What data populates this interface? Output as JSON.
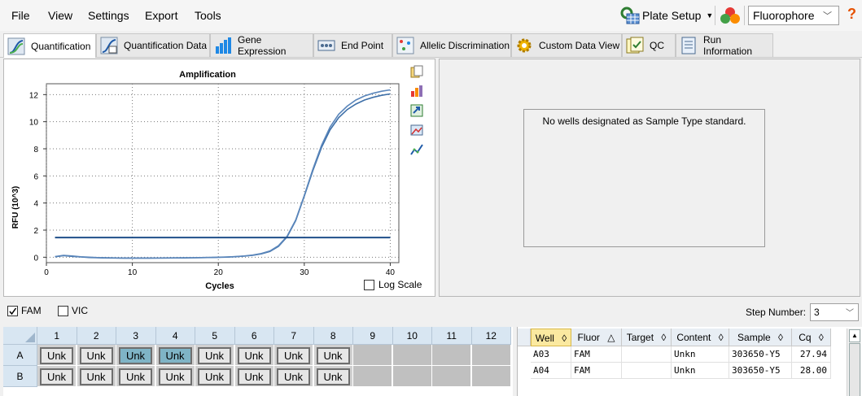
{
  "menu": [
    "File",
    "View",
    "Settings",
    "Export",
    "Tools"
  ],
  "toolbar": {
    "plate_setup": "Plate Setup",
    "fluorophore_select": "Fluorophore",
    "help": "?"
  },
  "tabs": [
    {
      "label": "Quantification",
      "active": true,
      "icon": "amplification-icon"
    },
    {
      "label": "Quantification Data",
      "active": false,
      "icon": "quant-data-icon"
    },
    {
      "label": "Gene Expression",
      "active": false,
      "icon": "bar-chart-icon"
    },
    {
      "label": "End Point",
      "active": false,
      "icon": "end-point-icon"
    },
    {
      "label": "Allelic Discrimination",
      "active": false,
      "icon": "scatter-icon"
    },
    {
      "label": "Custom Data View",
      "active": false,
      "icon": "gear-icon"
    },
    {
      "label": "QC",
      "active": false,
      "icon": "qc-icon"
    },
    {
      "label": "Run Information",
      "active": false,
      "icon": "document-icon"
    }
  ],
  "chart_data": {
    "type": "line",
    "title": "Amplification",
    "xlabel": "Cycles",
    "ylabel": "RFU (10^3)",
    "xlim": [
      0,
      41
    ],
    "ylim": [
      -0.4,
      12.8
    ],
    "xticks": [
      0,
      10,
      20,
      30,
      40
    ],
    "yticks": [
      0,
      2,
      4,
      6,
      8,
      10,
      12
    ],
    "grid": "dotted",
    "threshold": 1.45,
    "series": [
      {
        "x": [
          1,
          2,
          3,
          4,
          5,
          6,
          7,
          8,
          9,
          10,
          11,
          12,
          13,
          14,
          15,
          16,
          17,
          18,
          19,
          20,
          21,
          22,
          23,
          24,
          25,
          26,
          27,
          28,
          29,
          30,
          31,
          32,
          33,
          34,
          35,
          36,
          37,
          38,
          39,
          40
        ],
        "values": [
          0.03,
          0.12,
          0.06,
          0.02,
          -0.02,
          -0.04,
          -0.05,
          -0.06,
          -0.07,
          -0.07,
          -0.07,
          -0.07,
          -0.06,
          -0.06,
          -0.05,
          -0.05,
          -0.04,
          -0.03,
          -0.02,
          -0.01,
          0.01,
          0.04,
          0.08,
          0.14,
          0.25,
          0.42,
          0.8,
          1.5,
          2.7,
          4.5,
          6.4,
          8.1,
          9.4,
          10.3,
          10.9,
          11.3,
          11.6,
          11.8,
          11.95,
          12.05
        ],
        "color": "#3d6fa8"
      },
      {
        "x": [
          1,
          2,
          3,
          4,
          5,
          6,
          7,
          8,
          9,
          10,
          11,
          12,
          13,
          14,
          15,
          16,
          17,
          18,
          19,
          20,
          21,
          22,
          23,
          24,
          25,
          26,
          27,
          28,
          29,
          30,
          31,
          32,
          33,
          34,
          35,
          36,
          37,
          38,
          39,
          40
        ],
        "values": [
          0.05,
          0.14,
          0.09,
          0.03,
          0.0,
          -0.03,
          -0.04,
          -0.05,
          -0.06,
          -0.06,
          -0.06,
          -0.06,
          -0.06,
          -0.05,
          -0.05,
          -0.04,
          -0.04,
          -0.03,
          -0.02,
          0.0,
          0.02,
          0.05,
          0.09,
          0.16,
          0.27,
          0.46,
          0.85,
          1.55,
          2.75,
          4.55,
          6.5,
          8.25,
          9.6,
          10.55,
          11.15,
          11.6,
          11.9,
          12.1,
          12.25,
          12.35
        ],
        "color": "#5a86bb"
      }
    ],
    "threshold_color": "#1f4f8a"
  },
  "log_scale_label": "Log Scale",
  "chart_side_icons": [
    "copy-icon",
    "chart-colors-icon",
    "export-icon",
    "image-icon",
    "line-style-icon"
  ],
  "std_curve_message": "No wells designated as Sample Type standard.",
  "fluors": [
    {
      "label": "FAM",
      "checked": true
    },
    {
      "label": "VIC",
      "checked": false
    }
  ],
  "step": {
    "label": "Step Number:",
    "value": "3"
  },
  "plate": {
    "columns": [
      "1",
      "2",
      "3",
      "4",
      "5",
      "6",
      "7",
      "8",
      "9",
      "10",
      "11",
      "12"
    ],
    "rows": [
      {
        "label": "A",
        "wells": [
          "Unk",
          "Unk",
          "Unk",
          "Unk",
          "Unk",
          "Unk",
          "Unk",
          "Unk",
          "",
          "",
          "",
          ""
        ],
        "selected": [
          2,
          3
        ]
      },
      {
        "label": "B",
        "wells": [
          "Unk",
          "Unk",
          "Unk",
          "Unk",
          "Unk",
          "Unk",
          "Unk",
          "Unk",
          "",
          "",
          "",
          ""
        ],
        "selected": []
      }
    ]
  },
  "table": {
    "headers": [
      "Well",
      "Fluor",
      "Target",
      "Content",
      "Sample",
      "Cq"
    ],
    "rows": [
      [
        "A03",
        "FAM",
        "",
        "Unkn",
        "303650-Y5",
        "27.94"
      ],
      [
        "A04",
        "FAM",
        "",
        "Unkn",
        "303650-Y5",
        "28.00"
      ]
    ]
  }
}
